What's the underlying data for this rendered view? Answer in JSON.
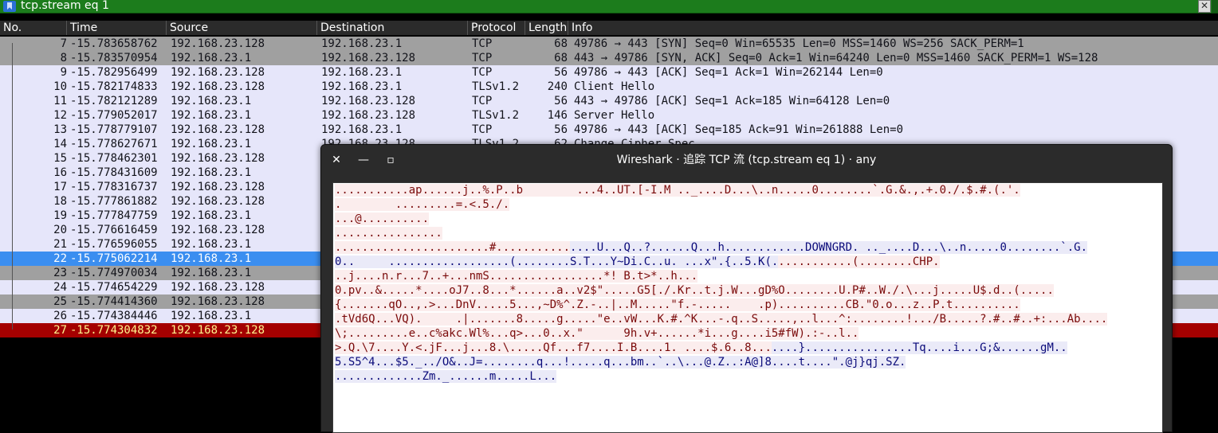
{
  "filter": {
    "text": "tcp.stream eq 1",
    "clear_label": "✕"
  },
  "columns": [
    "No.",
    "Time",
    "Source",
    "Destination",
    "Protocol",
    "Length",
    "Info"
  ],
  "packets": [
    {
      "no": "7",
      "time": "-15.783658762",
      "src": "192.168.23.128",
      "dst": "192.168.23.1",
      "proto": "TCP",
      "len": "68",
      "info": "49786 → 443 [SYN] Seq=0 Win=65535 Len=0 MSS=1460 WS=256 SACK_PERM=1",
      "style": "gray"
    },
    {
      "no": "8",
      "time": "-15.783570954",
      "src": "192.168.23.1",
      "dst": "192.168.23.128",
      "proto": "TCP",
      "len": "68",
      "info": "443 → 49786 [SYN, ACK] Seq=0 Ack=1 Win=64240 Len=0 MSS=1460 SACK_PERM=1 WS=128",
      "style": "gray"
    },
    {
      "no": "9",
      "time": "-15.782956499",
      "src": "192.168.23.128",
      "dst": "192.168.23.1",
      "proto": "TCP",
      "len": "56",
      "info": "49786 → 443 [ACK] Seq=1 Ack=1 Win=262144 Len=0",
      "style": "purple"
    },
    {
      "no": "10",
      "time": "-15.782174833",
      "src": "192.168.23.128",
      "dst": "192.168.23.1",
      "proto": "TLSv1.2",
      "len": "240",
      "info": "Client Hello",
      "style": "purple"
    },
    {
      "no": "11",
      "time": "-15.782121289",
      "src": "192.168.23.1",
      "dst": "192.168.23.128",
      "proto": "TCP",
      "len": "56",
      "info": "443 → 49786 [ACK] Seq=1 Ack=185 Win=64128 Len=0",
      "style": "purple"
    },
    {
      "no": "12",
      "time": "-15.779052017",
      "src": "192.168.23.1",
      "dst": "192.168.23.128",
      "proto": "TLSv1.2",
      "len": "146",
      "info": "Server Hello",
      "style": "purple"
    },
    {
      "no": "13",
      "time": "-15.778779107",
      "src": "192.168.23.128",
      "dst": "192.168.23.1",
      "proto": "TCP",
      "len": "56",
      "info": "49786 → 443 [ACK] Seq=185 Ack=91 Win=261888 Len=0",
      "style": "purple"
    },
    {
      "no": "14",
      "time": "-15.778627671",
      "src": "192.168.23.1",
      "dst": "192.168.23.128",
      "proto": "TLSv1.2",
      "len": "62",
      "info": "Change Cipher Spec",
      "style": "purple"
    },
    {
      "no": "15",
      "time": "-15.778462301",
      "src": "192.168.23.128",
      "dst": "",
      "proto": "",
      "len": "",
      "info": "",
      "style": "purple"
    },
    {
      "no": "16",
      "time": "-15.778431609",
      "src": "192.168.23.1",
      "dst": "",
      "proto": "",
      "len": "",
      "info": "",
      "style": "purple"
    },
    {
      "no": "17",
      "time": "-15.778316737",
      "src": "192.168.23.128",
      "dst": "",
      "proto": "",
      "len": "",
      "info": "",
      "style": "purple"
    },
    {
      "no": "18",
      "time": "-15.777861882",
      "src": "192.168.23.128",
      "dst": "",
      "proto": "",
      "len": "",
      "info": "",
      "style": "purple"
    },
    {
      "no": "19",
      "time": "-15.777847759",
      "src": "192.168.23.1",
      "dst": "",
      "proto": "",
      "len": "",
      "info": "",
      "style": "purple"
    },
    {
      "no": "20",
      "time": "-15.776616459",
      "src": "192.168.23.128",
      "dst": "",
      "proto": "",
      "len": "",
      "info": "",
      "style": "purple"
    },
    {
      "no": "21",
      "time": "-15.776596055",
      "src": "192.168.23.1",
      "dst": "",
      "proto": "",
      "len": "",
      "info": "",
      "style": "purple"
    },
    {
      "no": "22",
      "time": "-15.775062214",
      "src": "192.168.23.1",
      "dst": "",
      "proto": "",
      "len": "",
      "info": "",
      "style": "blue"
    },
    {
      "no": "23",
      "time": "-15.774970034",
      "src": "192.168.23.1",
      "dst": "",
      "proto": "",
      "len": "",
      "info": "",
      "style": "gray"
    },
    {
      "no": "24",
      "time": "-15.774654229",
      "src": "192.168.23.128",
      "dst": "",
      "proto": "",
      "len": "",
      "info": "",
      "style": "purple"
    },
    {
      "no": "25",
      "time": "-15.774414360",
      "src": "192.168.23.128",
      "dst": "",
      "proto": "",
      "len": "",
      "info": "",
      "style": "gray"
    },
    {
      "no": "26",
      "time": "-15.774384446",
      "src": "192.168.23.1",
      "dst": "",
      "proto": "",
      "len": "",
      "info": "",
      "style": "purple"
    },
    {
      "no": "27",
      "time": "-15.774304832",
      "src": "192.168.23.128",
      "dst": "",
      "proto": "",
      "len": "",
      "info": "",
      "style": "red"
    }
  ],
  "dialog": {
    "title": "Wireshark · 追踪 TCP 流 (tcp.stream eq 1) · any",
    "close_label": "✕",
    "minimize_label": "—",
    "maximize_label": "▫",
    "stream_lines": [
      [
        {
          "d": "c",
          "t": "...........ap......j..%.P..b        ...4..UT.[-I.M .._....D...\\..n.....0........`.G.&.,.+.0./.$.#.(.'."
        }
      ],
      [
        {
          "d": "c",
          "t": ".        .........=.<.5./."
        }
      ],
      [
        {
          "d": "c",
          "t": "...@.........."
        }
      ],
      [
        {
          "d": "c",
          "t": "................"
        }
      ],
      [
        {
          "d": "c",
          "t": ".......................#..........."
        },
        {
          "d": "s",
          "t": "....U...Q..?......Q...h............DOWNGRD. .._....D...\\..n.....0........`.G."
        }
      ],
      [
        {
          "d": "s",
          "t": "0..     ..................(........S.T...Y~Di.C..u. ...x\".{..5.K(."
        },
        {
          "d": "c",
          "t": "...........(........CHP."
        }
      ],
      [
        {
          "d": "c",
          "t": "..j....n.r...7..+...nmS.................*! B.t>*..h..."
        }
      ],
      [
        {
          "d": "c",
          "t": "0.pv..&.....*....oJ7..8...*......a..v2$\".....G5[./.Kr..t.j.W...gD%O........U.P#..W./.\\...j.....U$.d..(....."
        }
      ],
      [
        {
          "d": "c",
          "t": "{.......qO..,.>...DnV.....5...,~D%^.Z.-..|..M.....\"f.-.....    .p)..........CB.\"0.o...z..P.t.........."
        }
      ],
      [
        {
          "d": "c",
          "t": ".tVd6Q...VQ).     .|.......8.....g.....\"e..vW...K.#.^K...-.q..S.....,..l...^:........!.../B.....?.#..#..+:...Ab...."
        }
      ],
      [
        {
          "d": "c",
          "t": "\\;.........e..c%akc.Wl%...q>...0..x.\"      9h.v+......*i...g....i5#fW).:-..l.."
        }
      ],
      [
        {
          "d": "c",
          "t": ">.Q.\\7....Y.<.jF...j...8.\\.....Qf...f7....I.B....1. ....$.6..8..."
        },
        {
          "d": "s",
          "t": "....}................Tq....i...G;&......gM.."
        }
      ],
      [
        {
          "d": "s",
          "t": "5.S5^4...$5._../O&..J=........q...!.....q...bm..`..\\...@.Z..:A@]8....t....\".@j}qj.SZ."
        }
      ],
      [
        {
          "d": "s",
          "t": ".............Zm._......m.....L..."
        }
      ]
    ]
  }
}
